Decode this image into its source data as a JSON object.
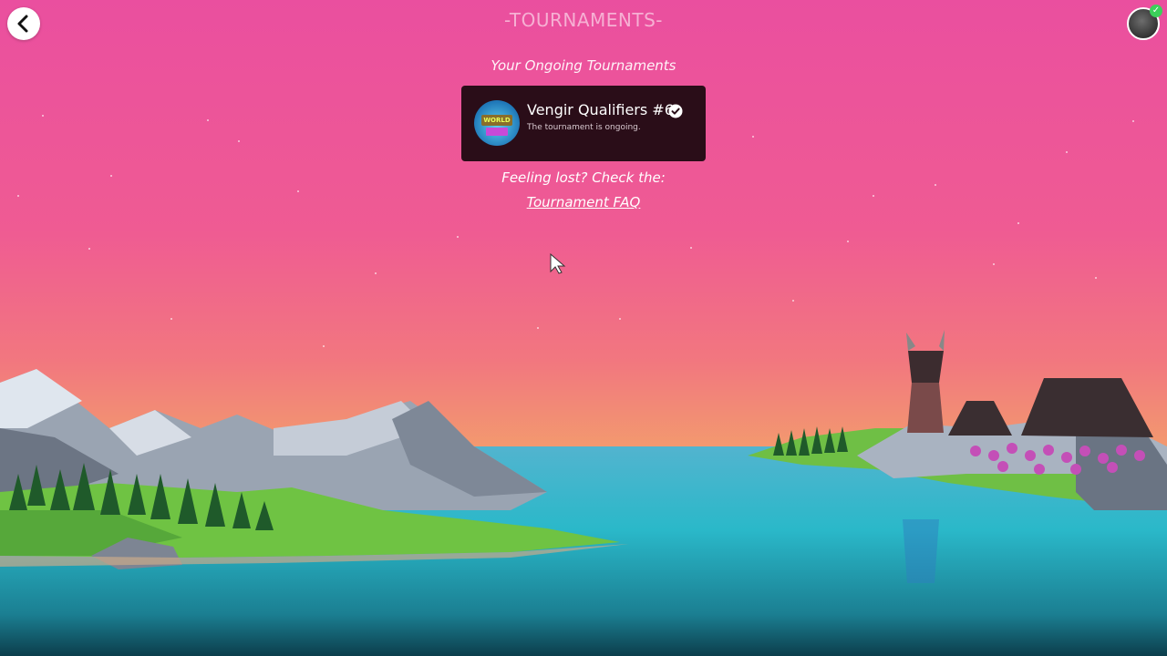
{
  "header": {
    "title": "-TOURNAMENTS-",
    "back_icon": "chevron-left-icon",
    "avatar_icon": "user-avatar",
    "online_badge": "check-icon"
  },
  "main": {
    "section_heading": "Your Ongoing Tournaments",
    "tournaments": [
      {
        "name": "Vengir Qualifiers #6",
        "status": "The tournament is ongoing.",
        "logo_text": "WORLD",
        "verified_icon": "verified-check-icon"
      }
    ],
    "help_text": "Feeling lost? Check the:",
    "faq_link": "Tournament FAQ"
  },
  "colors": {
    "sky_top": "#ea4f9f",
    "sky_bottom": "#f3a36a",
    "water": "#2ab8c9",
    "card_bg": "#2a0d18",
    "badge": "#3ccf5a"
  }
}
